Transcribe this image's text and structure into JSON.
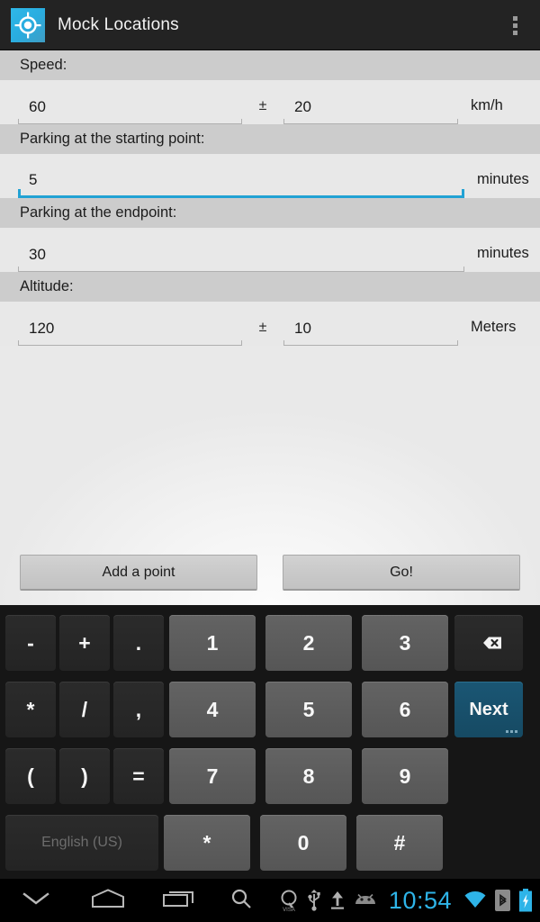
{
  "actionbar": {
    "title": "Mock Locations",
    "icon": "location-target-icon",
    "overflow_label": "More options",
    "bg": "#232323",
    "icon_bg": "#2fb8e8"
  },
  "form": {
    "sections": [
      {
        "header": "Speed:",
        "type": "pair",
        "value": "60",
        "separator": "±",
        "tolerance": "20",
        "unit": "km/h",
        "focused": false
      },
      {
        "header": "Parking at the starting point:",
        "type": "single",
        "value": "5",
        "unit": "minutes",
        "focused": true
      },
      {
        "header": "Parking at the endpoint:",
        "type": "single",
        "value": "30",
        "unit": "minutes",
        "focused": false
      },
      {
        "header": "Altitude:",
        "type": "pair",
        "value": "120",
        "separator": "±",
        "tolerance": "10",
        "unit": "Meters",
        "focused": false
      }
    ],
    "focus_color": "#22a2d4"
  },
  "buttons": {
    "add_point": "Add a point",
    "go": "Go!"
  },
  "keyboard": {
    "language": "English (US)",
    "next_label": "Next",
    "backspace": "backspace-icon",
    "rows": [
      [
        {
          "label": "-",
          "style": "dark"
        },
        {
          "label": "+",
          "style": "dark"
        },
        {
          "label": ".",
          "style": "dark"
        },
        {
          "label": "1",
          "style": "lite"
        },
        {
          "label": "2",
          "style": "lite"
        },
        {
          "label": "3",
          "style": "lite"
        },
        {
          "label": "backspace-icon",
          "style": "dark"
        }
      ],
      [
        {
          "label": "*",
          "style": "dark"
        },
        {
          "label": "/",
          "style": "dark"
        },
        {
          "label": ",",
          "style": "dark"
        },
        {
          "label": "4",
          "style": "lite"
        },
        {
          "label": "5",
          "style": "lite"
        },
        {
          "label": "6",
          "style": "lite"
        },
        {
          "label": "Next",
          "style": "next"
        }
      ],
      [
        {
          "label": "(",
          "style": "dark"
        },
        {
          "label": ")",
          "style": "dark"
        },
        {
          "label": "=",
          "style": "dark"
        },
        {
          "label": "7",
          "style": "lite"
        },
        {
          "label": "8",
          "style": "lite"
        },
        {
          "label": "9",
          "style": "lite"
        },
        {
          "label": "",
          "style": "blank"
        }
      ],
      [
        {
          "label": "English (US)",
          "style": "space"
        },
        {
          "label": "*",
          "style": "lite"
        },
        {
          "label": "0",
          "style": "lite"
        },
        {
          "label": "#",
          "style": "lite"
        },
        {
          "label": "",
          "style": "blank"
        }
      ]
    ]
  },
  "navbar": {
    "hide_keyboard": "chevron-down-icon",
    "home": "home-icon",
    "recents": "recent-apps-icon",
    "search": "search-icon",
    "status_icons": [
      "visa-icon",
      "usb-icon",
      "upload-icon",
      "android-icon"
    ],
    "visa_label": "VISA",
    "clock": "10:54",
    "clock_color": "#2eb4e8",
    "wifi": "wifi-icon",
    "bluetooth": "bluetooth-icon",
    "battery": "battery-charging-icon"
  }
}
